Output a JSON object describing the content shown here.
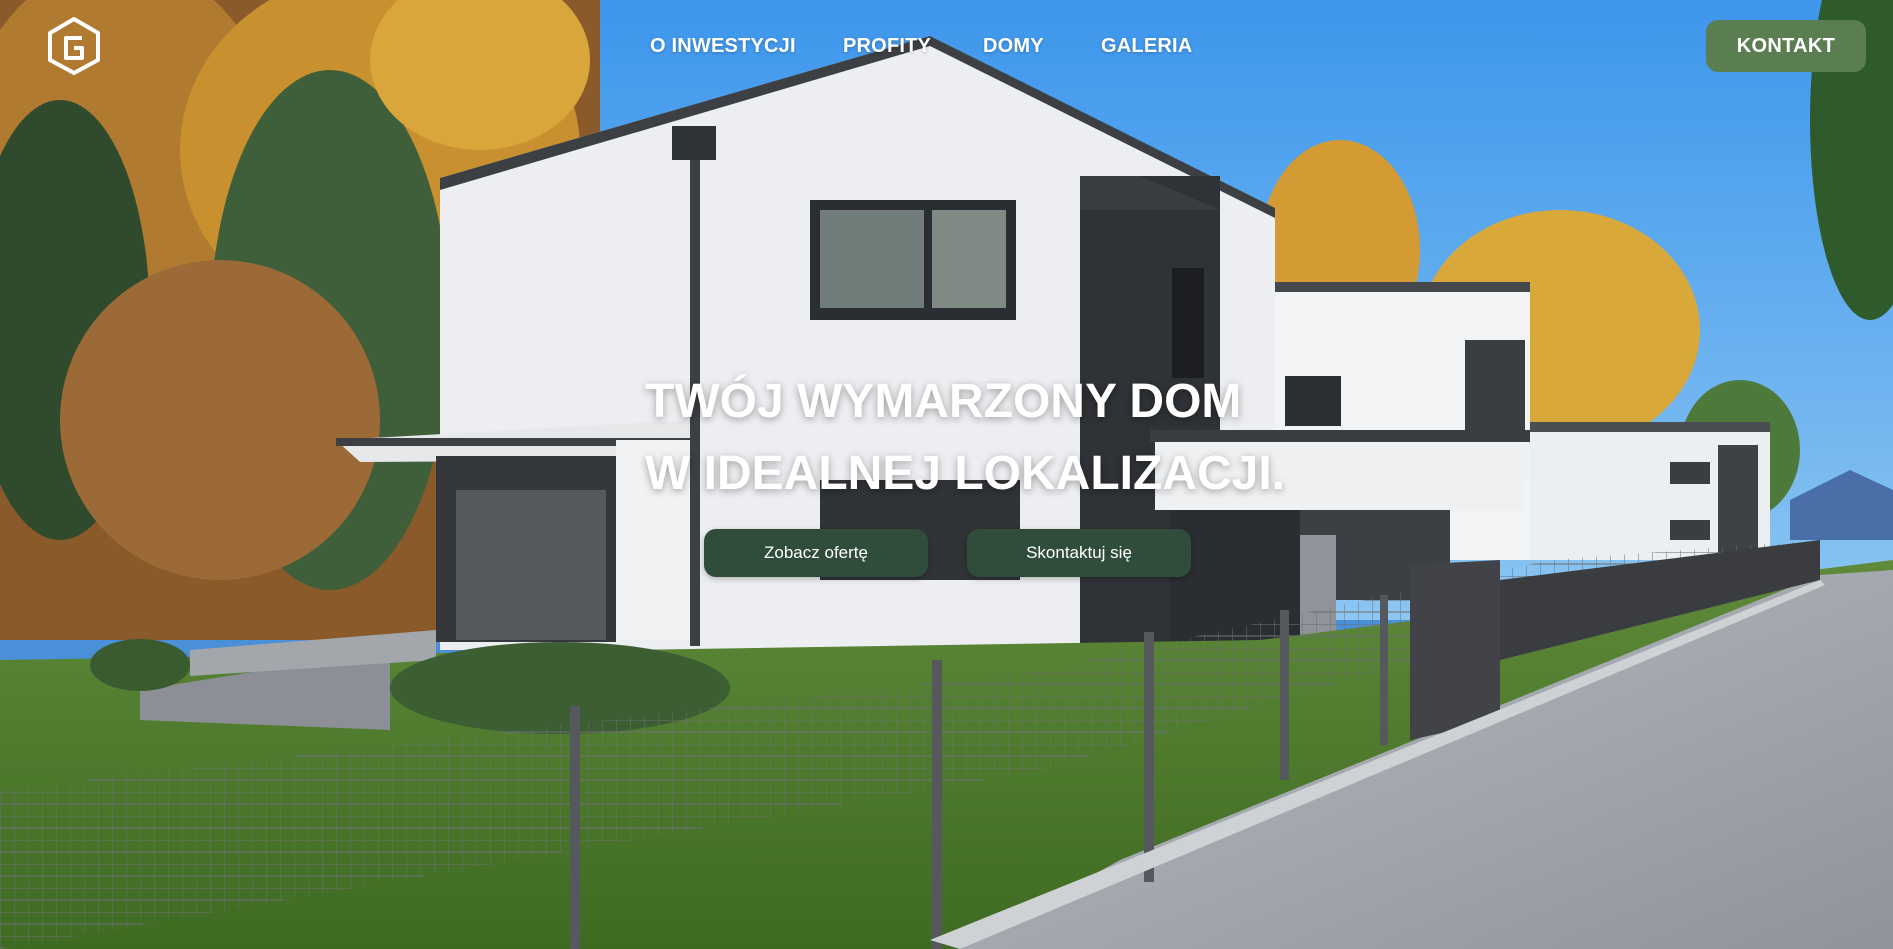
{
  "brand": {
    "logo_icon": "house-g-logo-icon"
  },
  "nav": {
    "items": [
      {
        "label": "O INWESTYCJI"
      },
      {
        "label": "PROFITY"
      },
      {
        "label": "DOMY"
      },
      {
        "label": "GALERIA"
      }
    ],
    "contact_label": "KONTAKT"
  },
  "hero": {
    "headline_line1": "TWÓJ WYMARZONY DOM",
    "headline_line2": "W IDEALNEJ LOKALIZACJI.",
    "primary_cta": "Zobacz ofertę",
    "secondary_cta": "Skontaktuj się"
  },
  "colors": {
    "contact_button": "#5a7d52",
    "cta_button": "#2f4d3a",
    "sky": "#5aa8ec",
    "text": "#ffffff"
  }
}
